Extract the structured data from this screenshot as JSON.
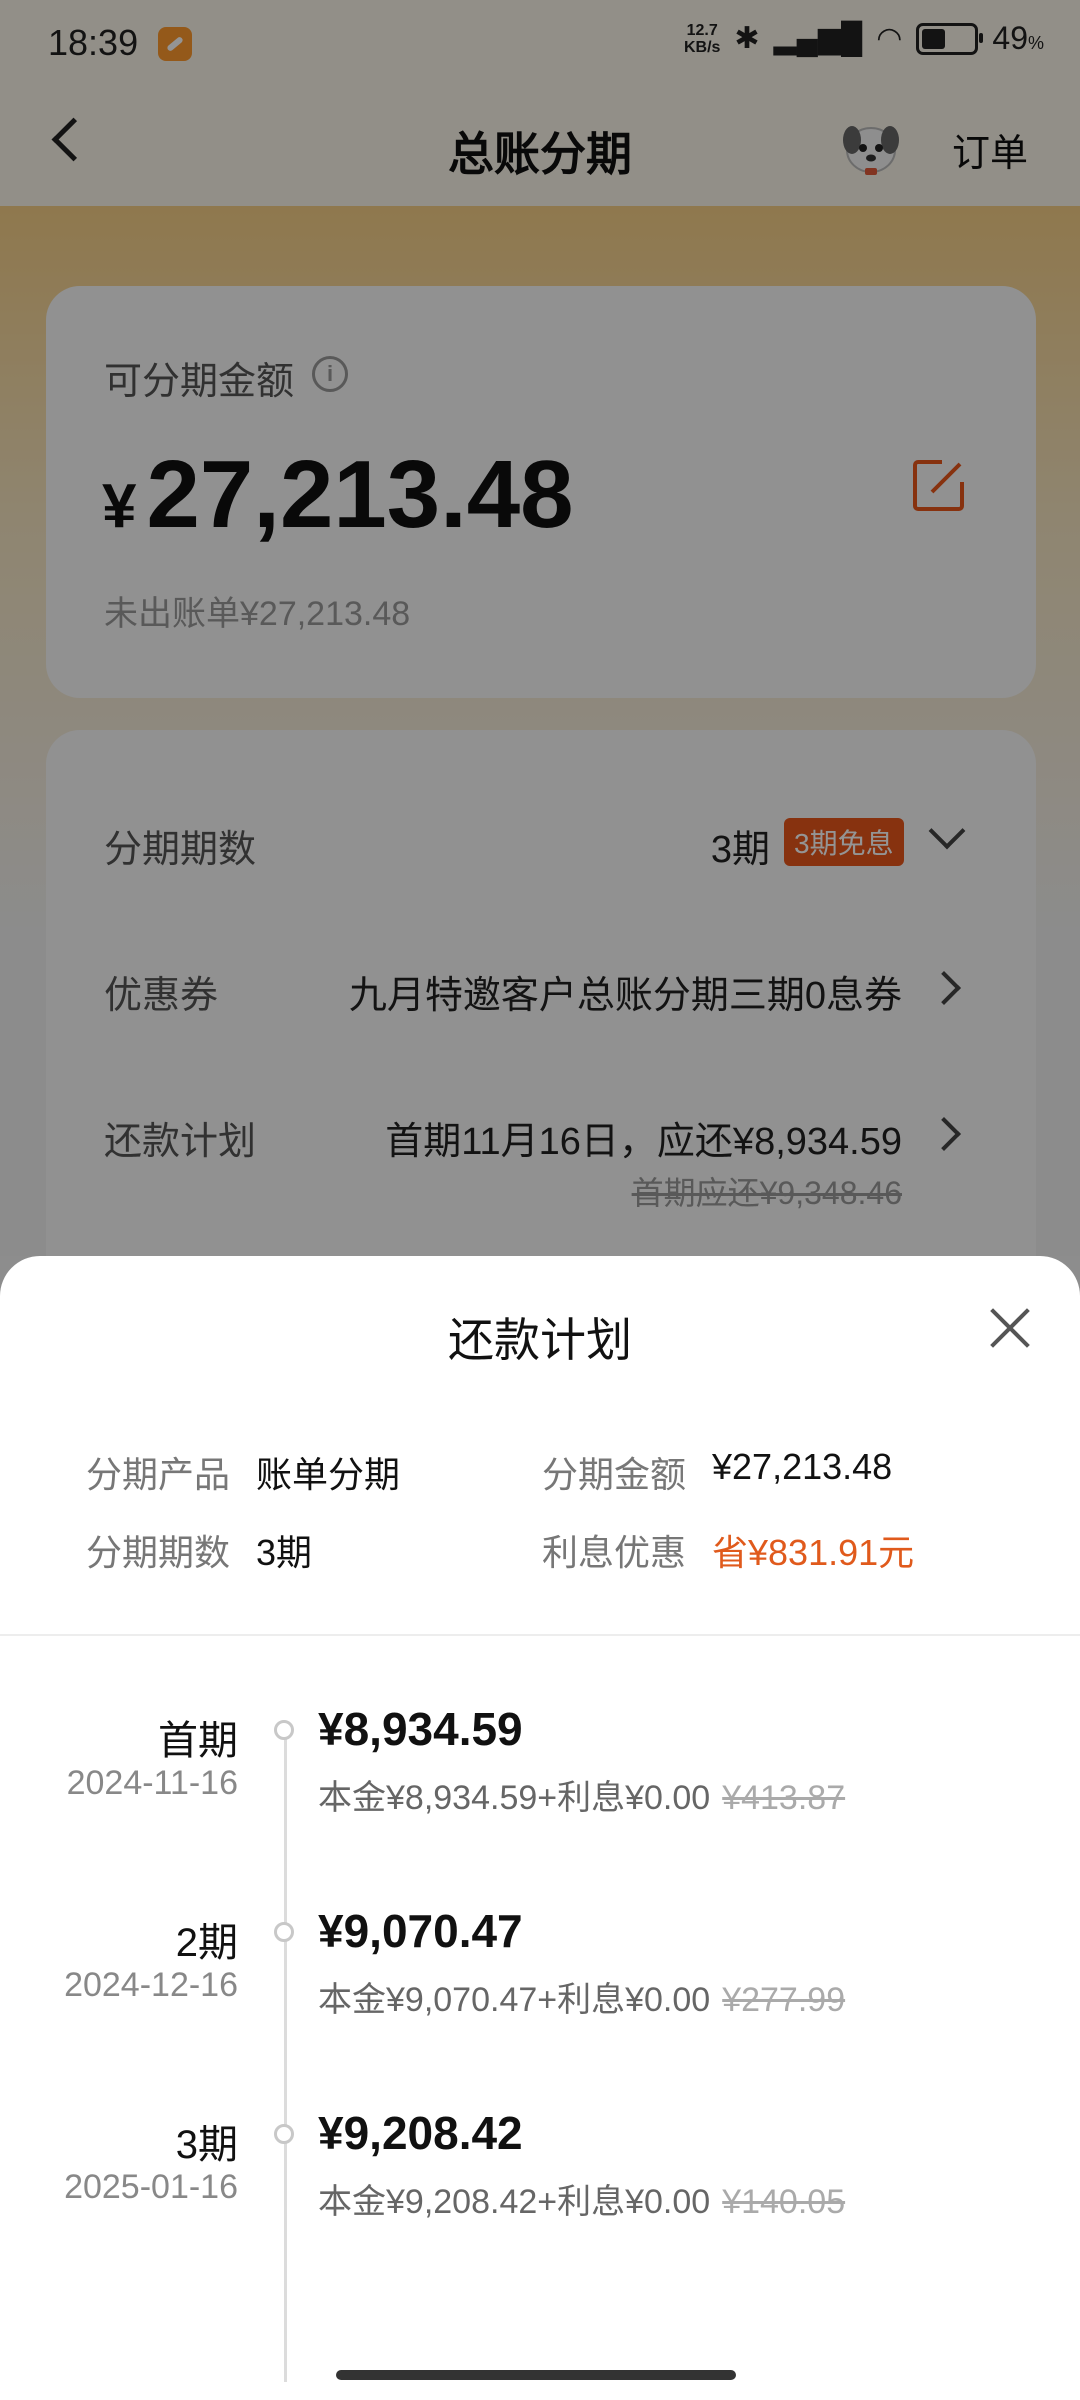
{
  "status_bar": {
    "time": "18:39",
    "net_speed_value": "12.7",
    "net_speed_unit": "KB/s",
    "battery_percent": "49",
    "battery_unit": "%",
    "icons": [
      "app-notification-icon",
      "bluetooth-icon",
      "hd-signal-icon",
      "wifi-icon",
      "battery-icon"
    ]
  },
  "nav": {
    "title": "总账分期",
    "right_link": "订单"
  },
  "installment": {
    "available_label": "可分期金额",
    "currency_symbol": "¥",
    "amount": "27,213.48",
    "unbilled": "未出账单¥27,213.48"
  },
  "options": {
    "periods_label": "分期期数",
    "periods_value": "3期",
    "periods_badge": "3期免息",
    "coupon_label": "优惠券",
    "coupon_value": "九月特邀客户总账分期三期0息券",
    "plan_label": "还款计划",
    "plan_value": "首期11月16日，应还¥8,934.59",
    "plan_original": "首期应还¥9,348.46"
  },
  "sheet": {
    "title": "还款计划",
    "product_label": "分期产品",
    "product_value": "账单分期",
    "amount_label": "分期金额",
    "amount_value": "¥27,213.48",
    "periods_label": "分期期数",
    "periods_value": "3期",
    "discount_label": "利息优惠",
    "discount_value": "省¥831.91元"
  },
  "schedule": [
    {
      "name": "首期",
      "date": "2024-11-16",
      "amount": "¥8,934.59",
      "detail": "本金¥8,934.59+利息¥0.00",
      "original_interest": "¥413.87"
    },
    {
      "name": "2期",
      "date": "2024-12-16",
      "amount": "¥9,070.47",
      "detail": "本金¥9,070.47+利息¥0.00",
      "original_interest": "¥277.99"
    },
    {
      "name": "3期",
      "date": "2025-01-16",
      "amount": "¥9,208.42",
      "detail": "本金¥9,208.42+利息¥0.00",
      "original_interest": "¥140.05"
    }
  ],
  "colors": {
    "accent_orange": "#e8561b",
    "discount_text": "#e05a1c",
    "header_gold": "#f6cf86"
  }
}
